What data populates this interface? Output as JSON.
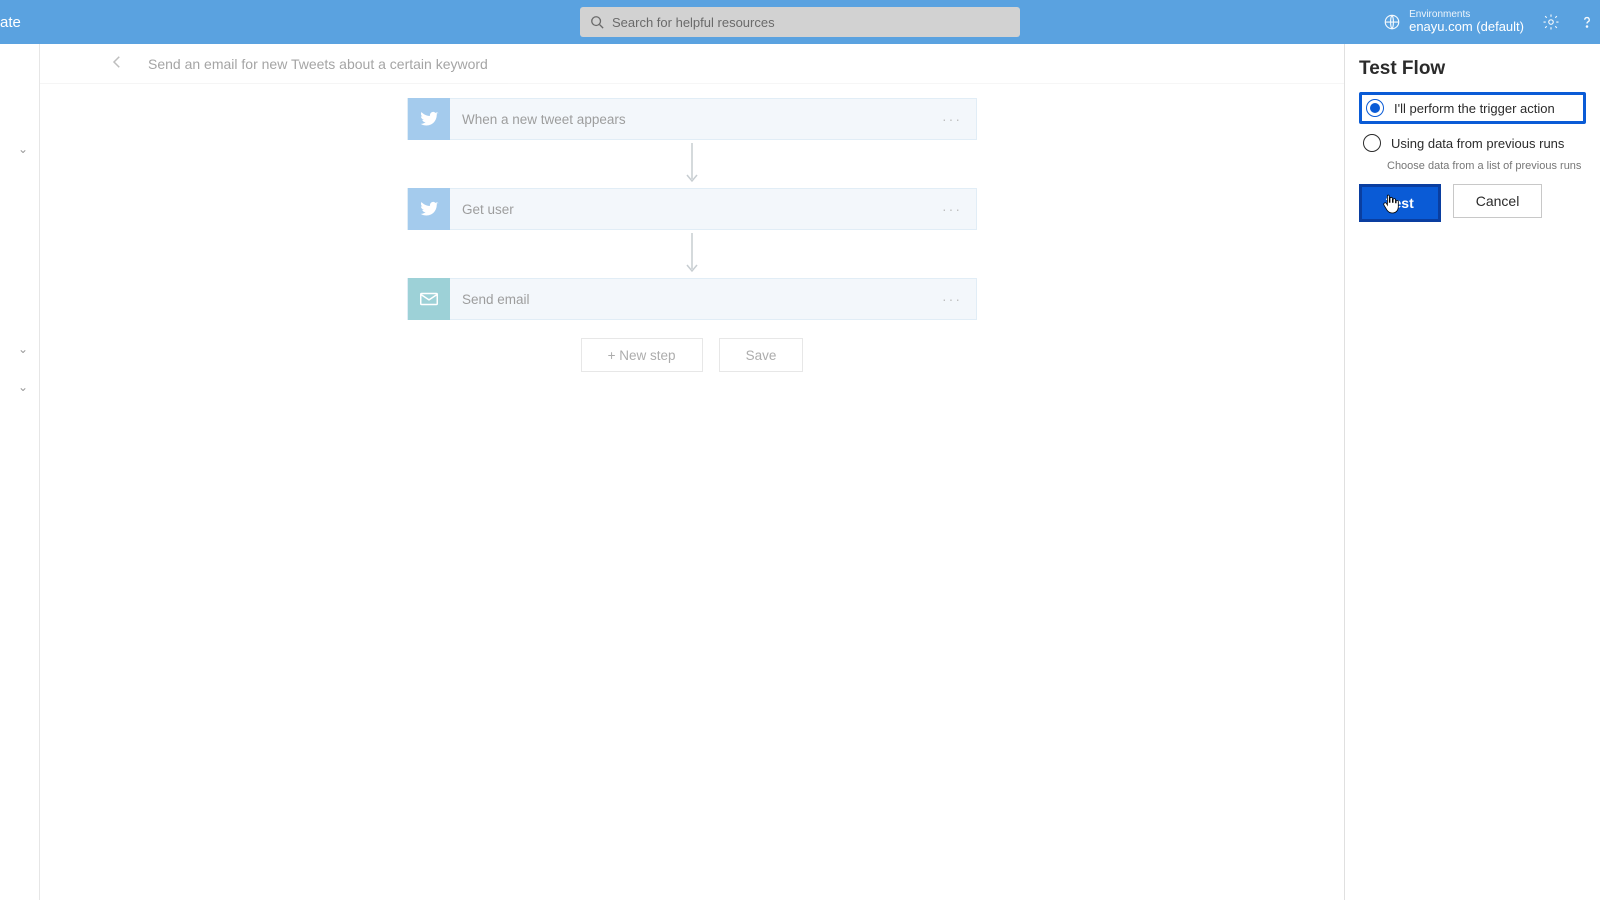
{
  "header": {
    "brand": "ate",
    "search_placeholder": "Search for helpful resources",
    "env_label": "Environments",
    "env_name": "enayu.com (default)"
  },
  "subhead": {
    "title": "Send an email for new Tweets about a certain keyword"
  },
  "steps": [
    {
      "label": "When a new tweet appears",
      "icon": "twitter"
    },
    {
      "label": "Get user",
      "icon": "twitter"
    },
    {
      "label": "Send email",
      "icon": "mail"
    }
  ],
  "buttons": {
    "new_step": "+ New step",
    "save": "Save"
  },
  "panel": {
    "title": "Test Flow",
    "option_perform": "I'll perform the trigger action",
    "option_previous": "Using data from previous runs",
    "hint": "Choose data from a list of previous runs",
    "test": "Test",
    "cancel": "Cancel"
  }
}
